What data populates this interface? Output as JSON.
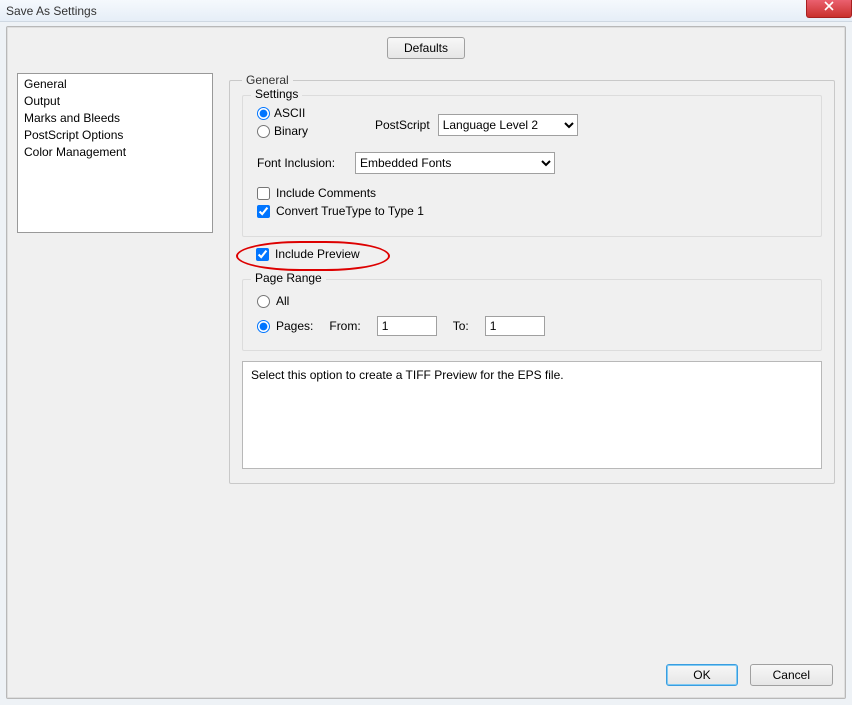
{
  "window": {
    "title": "Save As Settings"
  },
  "buttons": {
    "defaults": "Defaults",
    "ok": "OK",
    "cancel": "Cancel"
  },
  "sidebar": {
    "items": [
      "General",
      "Output",
      "Marks and Bleeds",
      "PostScript Options",
      "Color Management"
    ],
    "selected_index": 0
  },
  "panel": {
    "heading": "General",
    "settings": {
      "legend": "Settings",
      "format_options": {
        "ascii": "ASCII",
        "binary": "Binary",
        "selected": "ascii"
      },
      "postscript_label": "PostScript",
      "postscript_value": "Language Level 2",
      "font_inclusion_label": "Font Inclusion:",
      "font_inclusion_value": "Embedded Fonts",
      "include_comments": {
        "label": "Include Comments",
        "checked": false
      },
      "convert_tt": {
        "label": "Convert TrueType to Type 1",
        "checked": true
      },
      "include_preview": {
        "label": "Include Preview",
        "checked": true
      }
    },
    "page_range": {
      "legend": "Page Range",
      "all_label": "All",
      "pages_label": "Pages:",
      "from_label": "From:",
      "to_label": "To:",
      "from_value": "1",
      "to_value": "1",
      "selected": "pages"
    },
    "help_text": "Select this option to create a TIFF Preview for the EPS file."
  }
}
